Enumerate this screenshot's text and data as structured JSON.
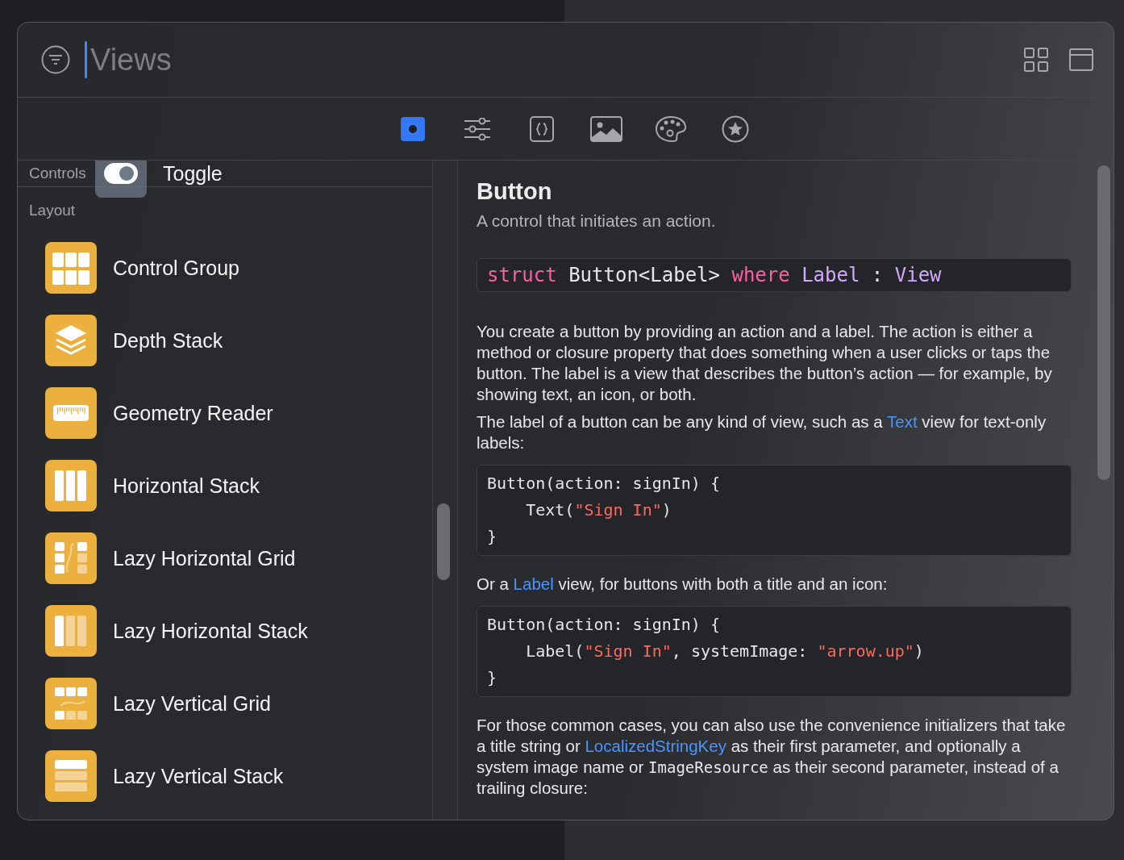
{
  "search": {
    "placeholder": "Views"
  },
  "tabs": [
    {
      "kind": "object",
      "selected": true
    },
    {
      "kind": "sliders",
      "selected": false
    },
    {
      "kind": "braces",
      "selected": false
    },
    {
      "kind": "image",
      "selected": false
    },
    {
      "kind": "palette",
      "selected": false
    },
    {
      "kind": "star",
      "selected": false
    }
  ],
  "sidebar": {
    "pinned_header": "Controls",
    "pinned_item": {
      "label": "Toggle",
      "kind": "toggle"
    },
    "section": "Layout",
    "items": [
      {
        "label": "Control Group",
        "kind": "grid"
      },
      {
        "label": "Depth Stack",
        "kind": "layers"
      },
      {
        "label": "Geometry Reader",
        "kind": "ruler"
      },
      {
        "label": "Horizontal Stack",
        "kind": "columns"
      },
      {
        "label": "Lazy Horizontal Grid",
        "kind": "lazy-hgrid"
      },
      {
        "label": "Lazy Horizontal Stack",
        "kind": "lazy-columns"
      },
      {
        "label": "Lazy Vertical Grid",
        "kind": "lazy-vgrid"
      },
      {
        "label": "Lazy Vertical Stack",
        "kind": "lazy-rows"
      }
    ]
  },
  "detail": {
    "title": "Button",
    "subtitle": "A control that initiates an action.",
    "declaration": [
      [
        {
          "t": "struct",
          "kind": "keyword"
        },
        {
          "t": " Button<Label> ",
          "kind": "plain"
        },
        {
          "t": "where",
          "kind": "keyword"
        },
        {
          "t": " Label",
          "kind": "type"
        },
        {
          "t": " : ",
          "kind": "plain"
        },
        {
          "t": "View",
          "kind": "type"
        }
      ]
    ],
    "blocks": [
      {
        "kind": "text",
        "segments": [
          {
            "t": "You create a button by providing an action and a label. The action is either a method or closure property that does something when a user clicks or taps the button. The label is a view that describes the button’s action — for example, by showing text, an icon, or both.",
            "kind": "plain"
          }
        ]
      },
      {
        "kind": "text",
        "segments": [
          {
            "t": "The label of a button can be any kind of view, such as a ",
            "kind": "plain"
          },
          {
            "t": "Text",
            "kind": "link"
          },
          {
            "t": " view for text-only labels:",
            "kind": "plain"
          }
        ]
      },
      {
        "kind": "code",
        "lines": [
          [
            {
              "t": "Button(action: signIn) {",
              "kind": "plain"
            }
          ],
          [
            {
              "t": "    Text(",
              "kind": "plain"
            },
            {
              "t": "\"Sign In\"",
              "kind": "string"
            },
            {
              "t": ")",
              "kind": "plain"
            }
          ],
          [
            {
              "t": "}",
              "kind": "plain"
            }
          ]
        ]
      },
      {
        "kind": "text",
        "segments": [
          {
            "t": "Or a ",
            "kind": "plain"
          },
          {
            "t": "Label",
            "kind": "link"
          },
          {
            "t": " view, for buttons with both a title and an icon:",
            "kind": "plain"
          }
        ]
      },
      {
        "kind": "code",
        "lines": [
          [
            {
              "t": "Button(action: signIn) {",
              "kind": "plain"
            }
          ],
          [
            {
              "t": "    Label(",
              "kind": "plain"
            },
            {
              "t": "\"Sign In\"",
              "kind": "string"
            },
            {
              "t": ", systemImage: ",
              "kind": "plain"
            },
            {
              "t": "\"arrow.up\"",
              "kind": "string"
            },
            {
              "t": ")",
              "kind": "plain"
            }
          ],
          [
            {
              "t": "}",
              "kind": "plain"
            }
          ]
        ]
      },
      {
        "kind": "text",
        "segments": [
          {
            "t": "For those common cases, you can also use the convenience initializers that take a title string or ",
            "kind": "plain"
          },
          {
            "t": "LocalizedStringKey",
            "kind": "link"
          },
          {
            "t": " as their first parameter, and optionally a system image name or ",
            "kind": "plain"
          },
          {
            "t": "ImageResource",
            "kind": "code"
          },
          {
            "t": " as their second parameter, instead of a trailing closure:",
            "kind": "plain"
          }
        ]
      }
    ]
  }
}
